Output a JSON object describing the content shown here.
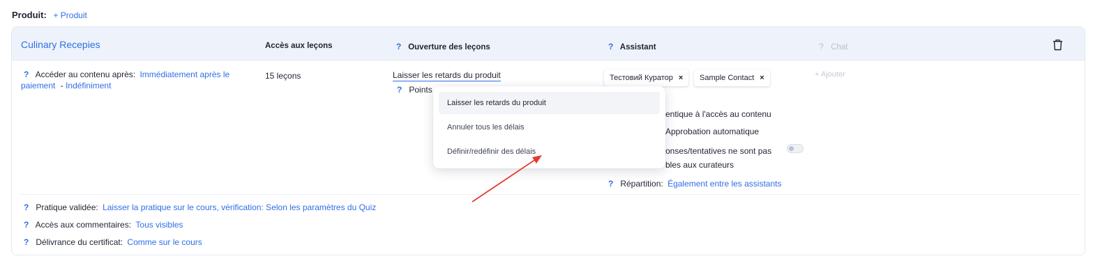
{
  "product": {
    "label": "Produit:",
    "add_link": "+ Produit"
  },
  "header": {
    "course_title": "Culinary Recepies",
    "col_access": "Accès aux leçons",
    "col_opening_q": "?",
    "col_opening": "Ouverture des leçons",
    "col_assistant_q": "?",
    "col_assistant": "Assistant",
    "col_chat_q": "?",
    "col_chat": "Chat",
    "delete_icon": "trash-icon"
  },
  "row": {
    "access_after_q": "?",
    "access_after_label": "Accéder au contenu après:",
    "access_after_value_line1": "Immédiatement après le",
    "access_after_value_line2": "paiement",
    "dash": "-",
    "duration_value": "Indéfiniment",
    "lessons_count": "15 leçons",
    "opening_value": "Laisser les retards du produit",
    "points_q": "?",
    "points_label": "Points",
    "assistants": [
      {
        "name": "Тестовий Куратор",
        "remove": "×"
      },
      {
        "name": "Sample Contact",
        "remove": "×"
      }
    ],
    "assistant_add_placeholder": "+ Ajouter",
    "auth_link_partial": "entique à l'accès au contenu",
    "auto_approval_link": "Approbation automatique",
    "answers_line1": "onses/tentatives ne sont pas",
    "answers_line2": "bles aux curateurs",
    "distribution_q": "?",
    "distribution_label": "Répartition:",
    "distribution_value": "Également entre les assistants"
  },
  "footer": {
    "practice_q": "?",
    "practice_label": "Pratique validée:",
    "practice_value": "Laisser la pratique sur le cours, vérification: Selon les paramètres du Quiz",
    "comments_q": "?",
    "comments_label": "Accès aux commentaires:",
    "comments_value": "Tous visibles",
    "certificate_q": "?",
    "certificate_label": "Délivrance du certificat:",
    "certificate_value": "Comme sur le cours"
  },
  "dropdown": {
    "options": [
      "Laisser les retards du produit",
      "Annuler tous les délais",
      "Définir/redéfinir des délais"
    ],
    "selected_index": 0
  },
  "colors": {
    "link": "#2f6ee6",
    "header_bg": "#eef3fb",
    "arrow": "#e53b2c"
  }
}
